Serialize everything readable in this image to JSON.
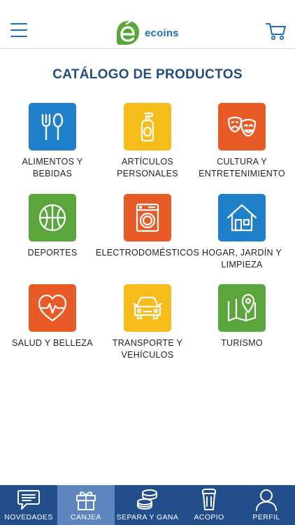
{
  "header": {
    "brand": "ecoins"
  },
  "page": {
    "title": "CATÁLOGO DE PRODUCTOS"
  },
  "categories": [
    {
      "label": "ALIMENTOS Y\nBEBIDAS",
      "color": "#1f7fc9",
      "icon": "fork-spoon-icon"
    },
    {
      "label": "ARTÍCULOS\nPERSONALES",
      "color": "#f6bd1a",
      "icon": "soap-bottle-icon"
    },
    {
      "label": "CULTURA Y\nENTRETENIMIENTO",
      "color": "#e85a26",
      "icon": "theater-masks-icon"
    },
    {
      "label": "DEPORTES",
      "color": "#5aa63c",
      "icon": "basketball-icon"
    },
    {
      "label": "ELECTRODOMÉSTICOS",
      "color": "#e85a26",
      "icon": "washing-machine-icon"
    },
    {
      "label": "HOGAR, JARDÍN Y\nLIMPIEZA",
      "color": "#1f7fc9",
      "icon": "house-icon"
    },
    {
      "label": "SALUD Y BELLEZA",
      "color": "#e85a26",
      "icon": "heart-pulse-icon"
    },
    {
      "label": "TRANSPORTE Y\nVEHÍCULOS",
      "color": "#f6bd1a",
      "icon": "car-icon"
    },
    {
      "label": "TURISMO",
      "color": "#5aa63c",
      "icon": "map-pin-icon"
    }
  ],
  "nav": {
    "items": [
      {
        "label": "NOVEDADES",
        "icon": "chat-bubble-icon"
      },
      {
        "label": "CANJEA",
        "icon": "gift-icon",
        "active": true
      },
      {
        "label": "SEPARA Y GANA",
        "icon": "coins-icon"
      },
      {
        "label": "ACOPIO",
        "icon": "trash-bin-icon"
      },
      {
        "label": "PERFIL",
        "icon": "user-icon"
      }
    ]
  },
  "colors": {
    "primary": "#1f6fb5",
    "title": "#234e7c",
    "nav_bg": "#234e8c",
    "nav_active": "#5d86bf",
    "brand_green": "#5aa63c"
  }
}
